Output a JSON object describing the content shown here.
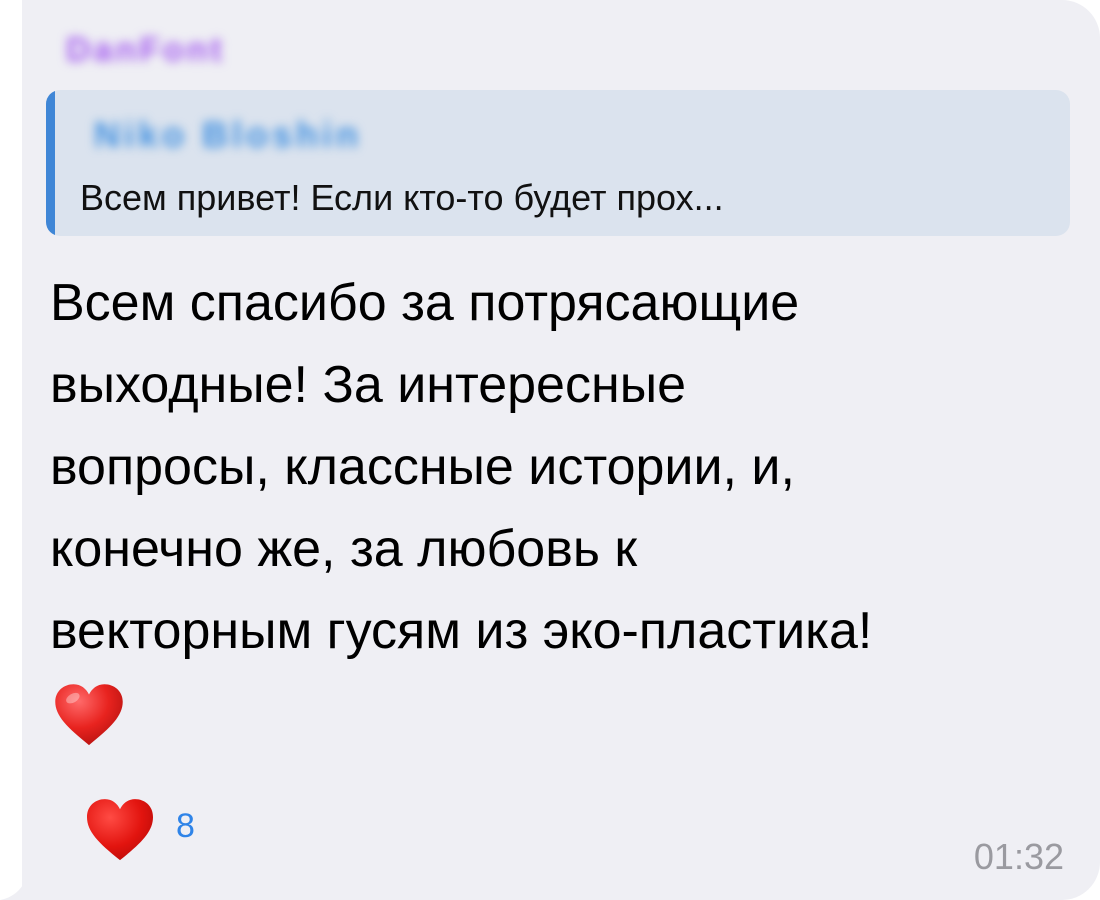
{
  "message": {
    "sender_name": "DanFont",
    "reply": {
      "author": "Niko Bloshin",
      "text": "Всем привет! Если кто-то будет прох..."
    },
    "text": "Всем спасибо за потрясающие\nвыходные! За интересные\nвопросы, классные истории, и,\nконечно же, за любовь к\nвекторным гусям из эко-пластика!",
    "emoji": "heart-emoji",
    "reaction": {
      "icon": "heart-icon",
      "count": "8"
    },
    "time": "01:32"
  },
  "colors": {
    "bubble": "#efeff4",
    "sender": "#a35af0",
    "reply_background": "#dbe3ee",
    "reply_accent": "#3f86d6",
    "reaction_count": "#2f84e8",
    "timestamp": "#9a9aa0",
    "heart": "#e0201f"
  }
}
